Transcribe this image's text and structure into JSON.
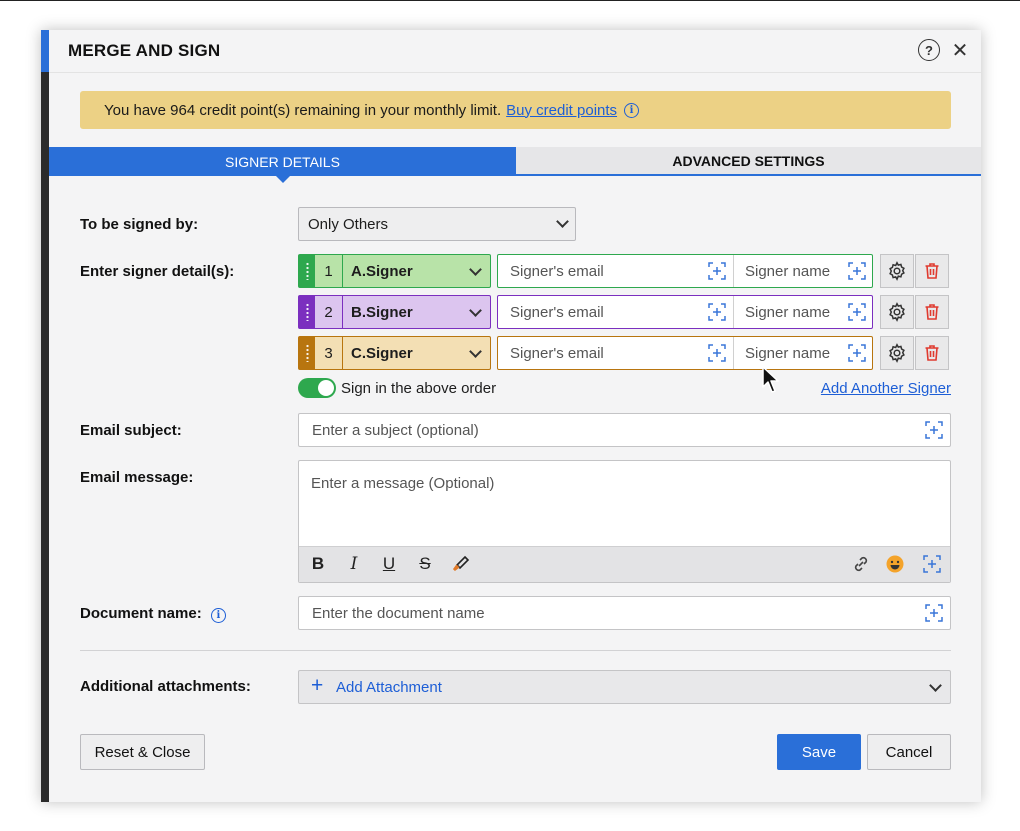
{
  "dialog": {
    "title": "MERGE AND SIGN",
    "help_icon": "?",
    "close_icon": "✕"
  },
  "banner": {
    "text": "You have 964 credit point(s) remaining in your monthly limit.",
    "link": "Buy credit points",
    "info_icon": "i",
    "color": "#ecd185"
  },
  "tabs": [
    {
      "label": "SIGNER DETAILS",
      "active": true
    },
    {
      "label": "ADVANCED SETTINGS",
      "active": false
    }
  ],
  "form": {
    "signed_by_label": "To be signed by:",
    "signed_by_value": "Only Others",
    "signer_details_label": "Enter signer detail(s):",
    "signers": [
      {
        "number": "1",
        "name": "A.Signer",
        "email_placeholder": "Signer's email",
        "name_placeholder": "Signer name",
        "color": "#2ea84e",
        "fill": "#b8e3a8"
      },
      {
        "number": "2",
        "name": "B.Signer",
        "email_placeholder": "Signer's email",
        "name_placeholder": "Signer name",
        "color": "#7b2fbf",
        "fill": "#dcc5ef"
      },
      {
        "number": "3",
        "name": "C.Signer",
        "email_placeholder": "Signer's email",
        "name_placeholder": "Signer name",
        "color": "#b8750f",
        "fill": "#f3dfb4"
      }
    ],
    "sign_order_label": "Sign in the above order",
    "add_signer_link": "Add Another Signer",
    "email_subject_label": "Email subject:",
    "email_subject_placeholder": "Enter a subject (optional)",
    "email_message_label": "Email message:",
    "email_message_placeholder": "Enter a message (Optional)",
    "toolbar": {
      "bold": "B",
      "italic": "I",
      "underline": "U",
      "strike": "S"
    },
    "document_name_label": "Document name:",
    "document_name_info": "i",
    "document_name_placeholder": "Enter the document name",
    "attachments_label": "Additional attachments:",
    "add_attachment_plus": "+",
    "add_attachment_label": "Add Attachment"
  },
  "buttons": {
    "reset": "Reset & Close",
    "save": "Save",
    "cancel": "Cancel"
  },
  "colors": {
    "accent": "#2a6fd8",
    "delete": "#e03a2f"
  }
}
